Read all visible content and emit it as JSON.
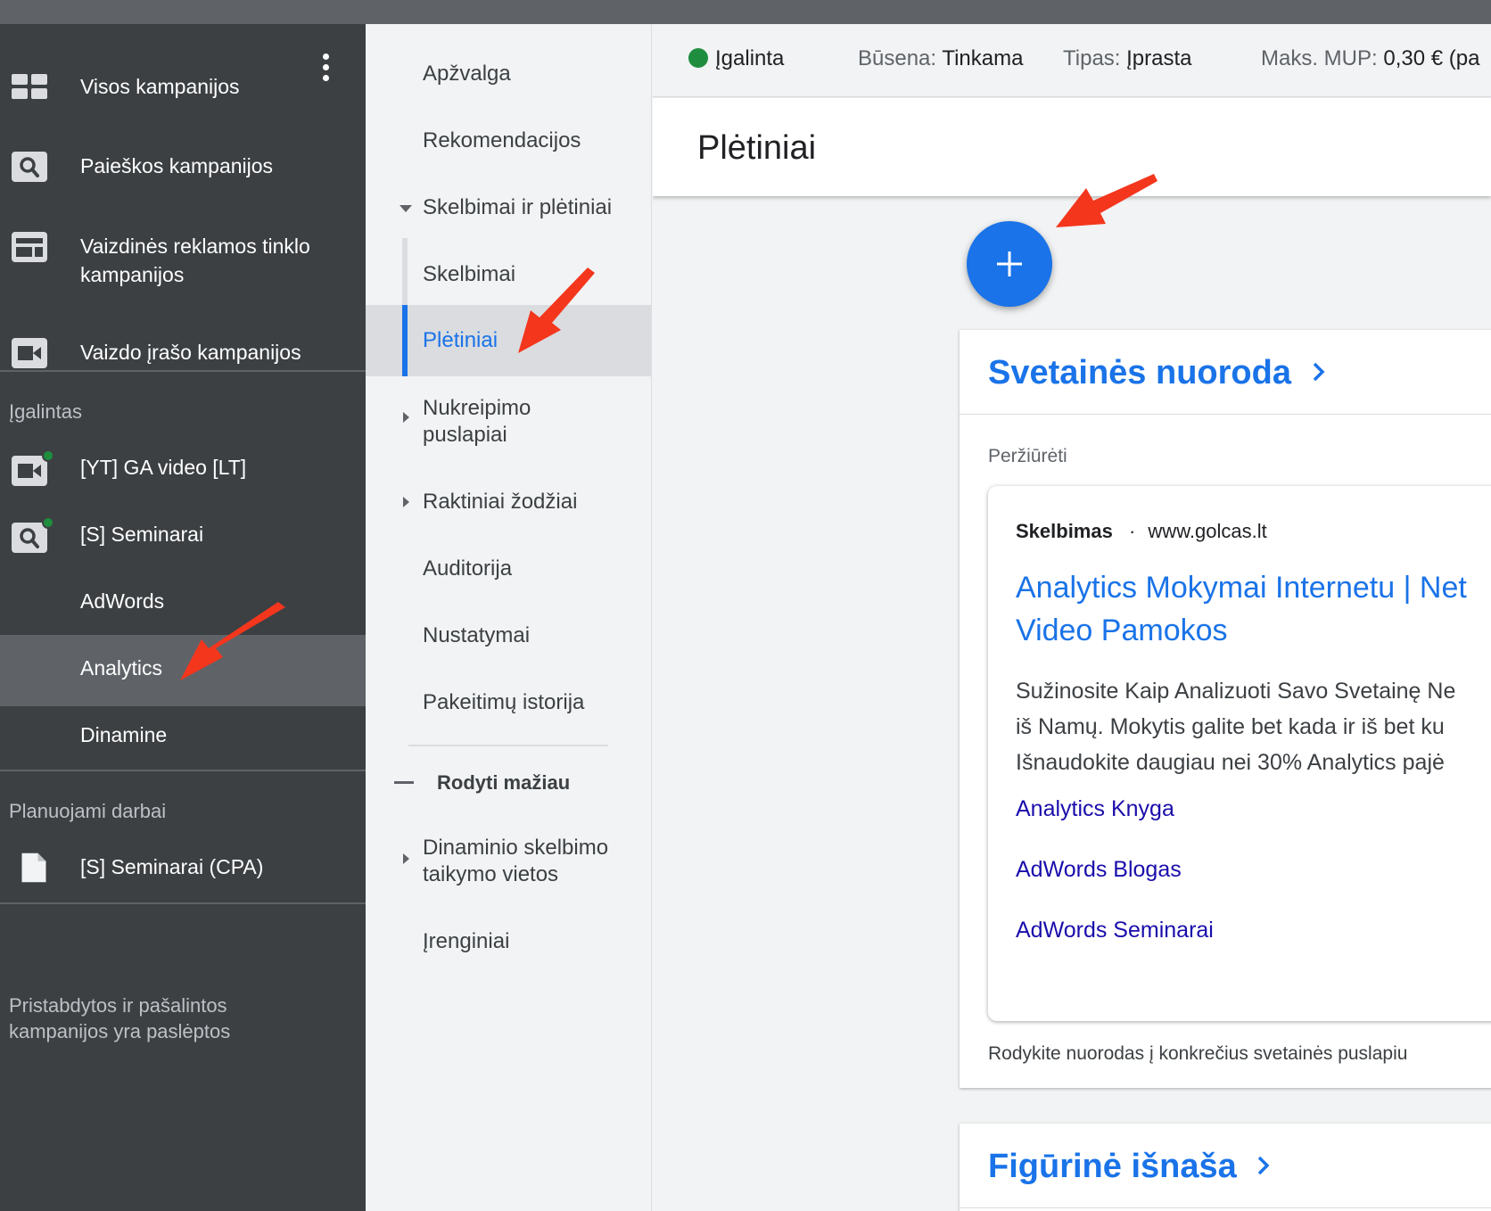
{
  "sidebar": {
    "campaign_types": [
      {
        "label": "Visos kampanijos",
        "icon": "grid-icon"
      },
      {
        "label": "Paieškos kampanijos",
        "icon": "search-icon"
      },
      {
        "label": "Vaizdinės reklamos tinklo kampanijos",
        "icon": "display-icon"
      },
      {
        "label": "Vaizdo įrašo kampanijos",
        "icon": "video-icon"
      }
    ],
    "enabled_label": "Įgalintas",
    "campaigns": [
      {
        "label": "[YT] GA video [LT]",
        "icon": "video-icon"
      },
      {
        "label": "[S] Seminarai",
        "icon": "search-icon"
      },
      {
        "label": "AdWords",
        "icon": ""
      },
      {
        "label": "Analytics",
        "icon": ""
      },
      {
        "label": "Dinamine",
        "icon": ""
      }
    ],
    "planned_label": "Planuojami darbai",
    "planned": [
      {
        "label": "[S] Seminarai (CPA)",
        "icon": "document-icon"
      }
    ],
    "footnote_line1": "Pristabdytos ir pašalintos",
    "footnote_line2": "kampanijos yra paslėptos"
  },
  "nav": {
    "overview": "Apžvalga",
    "recommendations": "Rekomendacijos",
    "ads_ext": "Skelbimai ir plėtiniai",
    "ads": "Skelbimai",
    "extensions": "Plėtiniai",
    "landing_pages_1": "Nukreipimo",
    "landing_pages_2": "puslapiai",
    "keywords": "Raktiniai žodžiai",
    "audience": "Auditorija",
    "settings": "Nustatymai",
    "history": "Pakeitimų istorija",
    "show_less": "Rodyti mažiau",
    "dsa_1": "Dinaminio skelbimo",
    "dsa_2": "taikymo vietos",
    "devices": "Įrenginiai"
  },
  "status": {
    "enabled": "Įgalinta",
    "state_label": "Būsena:",
    "state_value": "Tinkama",
    "type_label": "Tipas:",
    "type_value": "Įprasta",
    "cpc_label": "Maks. MUP:",
    "cpc_value": "0,30 € (pa"
  },
  "page_title": "Plėtiniai",
  "sitelink_card": {
    "title": "Svetainės nuoroda",
    "preview_label": "Peržiūrėti",
    "ad_badge": "Skelbimas",
    "ad_url": "www.golcas.lt",
    "ad_title_1": "Analytics Mokymai Internetu | Net",
    "ad_title_2": "Video Pamokos",
    "ad_desc_1": "Sužinosite Kaip Analizuoti Savo Svetainę Ne",
    "ad_desc_2": "iš Namų. Mokytis galite bet kada ir iš bet ku",
    "ad_desc_3": "Išnaudokite daugiau nei 30% Analytics pajė",
    "sitelinks": [
      "Analytics Knyga",
      "AdWords Blogas",
      "AdWords Seminarai"
    ],
    "footer": "Rodykite nuorodas į konkrečius svetainės puslapiu"
  },
  "callout_card": {
    "title": "Figūrinė išnaša"
  },
  "colors": {
    "sidebar_bg": "#3c4043",
    "accent": "#1a73e8",
    "status_green": "#1e8e3e",
    "arrow_red": "#f4361d"
  }
}
